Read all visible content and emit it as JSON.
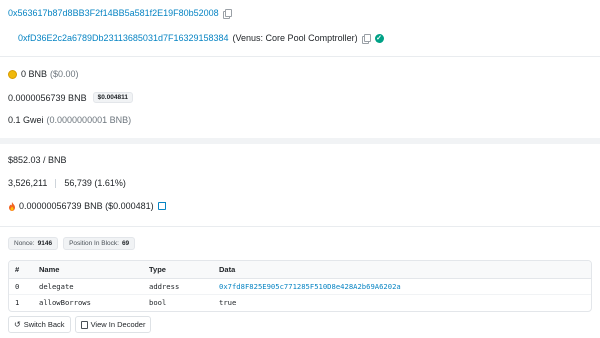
{
  "addresses": {
    "from_address": "0x563617b87d8BB3F2f14BB5a581f2E19F80b52008",
    "to_address": "0xfD36E2c2a6789Db23113685031d7F16329158384",
    "to_name": "(Venus: Core Pool Comptroller)"
  },
  "value": {
    "amount": "0 BNB",
    "fiat": "($0.00)"
  },
  "fee": {
    "amount": "0.0000056739 BNB",
    "fiat_badge": "$0.004811"
  },
  "gas_price": {
    "gwei": "0.1 Gwei",
    "bnb": "(0.0000000001 BNB)"
  },
  "price": {
    "bnb_price": "$852.03 / BNB"
  },
  "gas_usage": {
    "limit": "3,526,211",
    "used": "56,739 (1.61%)"
  },
  "burnt": {
    "text": "0.00000056739 BNB ($0.000481)"
  },
  "meta_pills": {
    "nonce_label": "Nonce:",
    "nonce_value": "9146",
    "position_label": "Position In Block:",
    "position_value": "69"
  },
  "input_table": {
    "headers": [
      "#",
      "Name",
      "Type",
      "Data"
    ],
    "rows": [
      {
        "index": "0",
        "name": "delegate",
        "type": "address",
        "data": "0x7fd8F825E905c771285F510D8e428A2b69A6202a"
      },
      {
        "index": "1",
        "name": "allowBorrows",
        "type": "bool",
        "data": "true"
      }
    ]
  },
  "buttons": {
    "switch_back": "Switch Back",
    "view_decoder": "View In Decoder"
  },
  "colors": {
    "link": "#0784c3",
    "verified": "#00a186",
    "bnb": "#f0b90b"
  }
}
